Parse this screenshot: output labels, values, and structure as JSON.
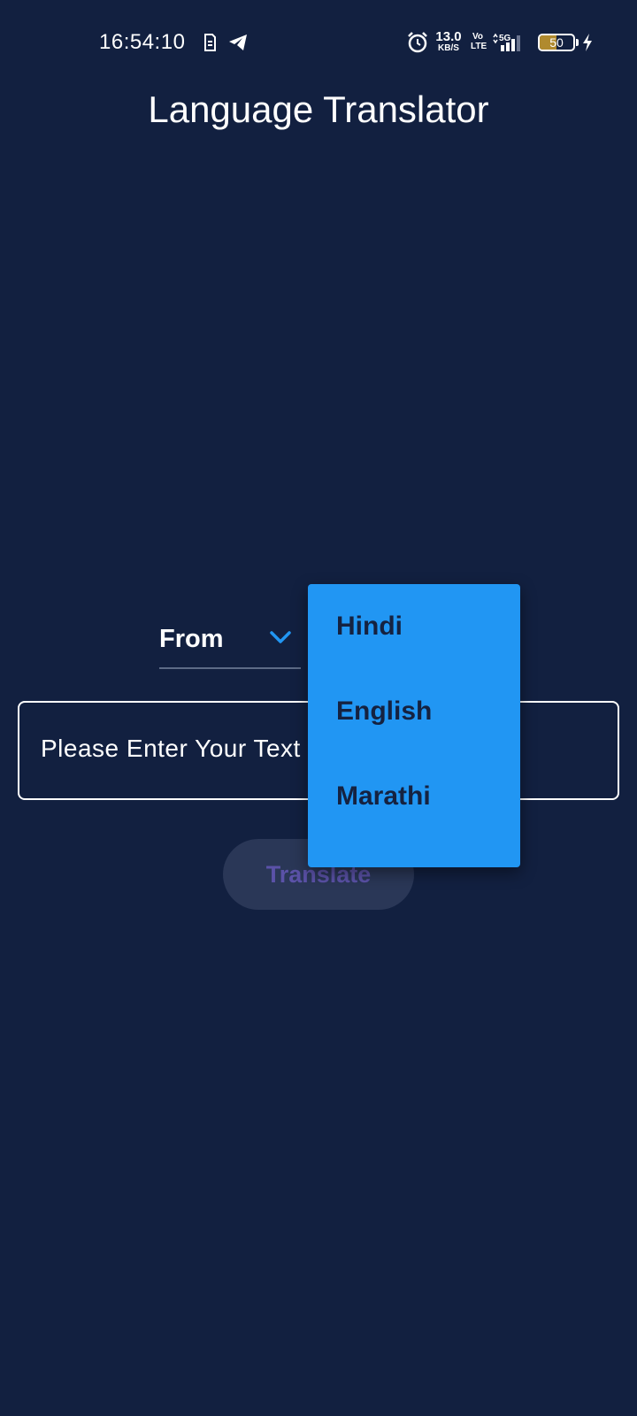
{
  "status_bar": {
    "time": "16:54:10",
    "net_speed_value": "13.0",
    "net_speed_unit": "KB/S",
    "volte_top": "Vo",
    "volte_bottom": "LTE",
    "battery_level": "50",
    "icons": [
      "sim-card-icon",
      "telegram-icon",
      "alarm-icon",
      "5g-signal-icon",
      "battery-icon",
      "charging-bolt-icon"
    ]
  },
  "app": {
    "title": "Language Translator"
  },
  "from_dropdown": {
    "label": "From",
    "icon": "chevron-down-icon",
    "accent_color": "#2196f3"
  },
  "text_input": {
    "placeholder": "Please Enter Your Text"
  },
  "translate_button": {
    "label": "Translate"
  },
  "language_menu": {
    "items": [
      {
        "label": "Hindi"
      },
      {
        "label": "English"
      },
      {
        "label": "Marathi"
      }
    ],
    "background_color": "#2196f3"
  },
  "colors": {
    "background": "#122040",
    "button_bg": "#2a3757",
    "button_text": "#5b52a8"
  }
}
